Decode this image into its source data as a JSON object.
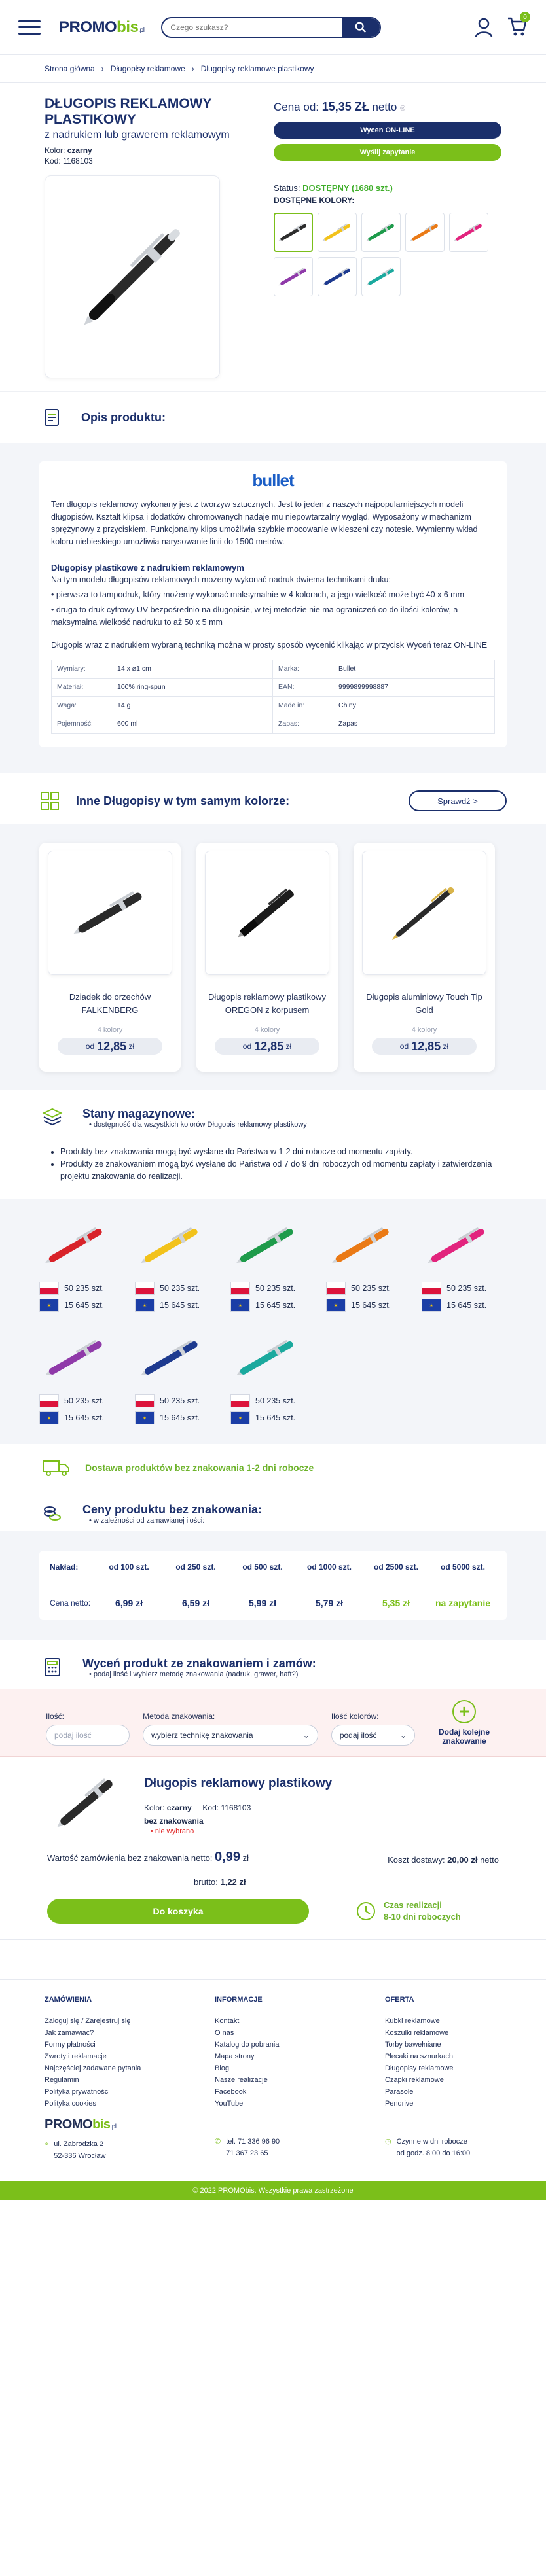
{
  "header": {
    "logo_main": "PROMO",
    "logo_accent": "bis",
    "logo_suffix": ".pl",
    "search_placeholder": "Czego szukasz?",
    "cart_count": "0"
  },
  "breadcrumb": [
    "Strona główna",
    "Długopisy reklamowe",
    "Długopisy reklamowe plastikowy"
  ],
  "product": {
    "title": "DŁUGOPIS REKLAMOWY PLASTIKOWY",
    "subtitle": "z nadrukiem lub grawerem reklamowym",
    "color_label": "Kolor:",
    "color_value": "czarny",
    "code_label": "Kod:",
    "code_value": "1168103",
    "price_prefix": "Cena od:",
    "price_value": "15,35 ZŁ",
    "price_suffix": "netto",
    "btn_online": "Wycen ON-LINE",
    "btn_inquiry": "Wyślij zapytanie",
    "status_label": "Status:",
    "status_value": "DOSTĘPNY (1680 szt.)",
    "available_colors": "DOSTĘPNE KOLORY:",
    "swatches": [
      "#2d2d2d",
      "#f2c21b",
      "#1e9b4b",
      "#ea7a16",
      "#e2247e",
      "#8f3aa9",
      "#1d3a8f",
      "#1ba99e"
    ]
  },
  "description": {
    "heading": "Opis produktu:",
    "brand": "bullet",
    "p1": "Ten długopis reklamowy wykonany jest z tworzyw sztucznych. Jest to jeden z naszych najpopularniejszych modeli długopisów. Kształt klipsa i dodatków chromowanych nadaje mu niepowtarzalny wygląd. Wyposażony w mechanizm sprężynowy z przyciskiem. Funkcjonalny klips umożliwia szybkie mocowanie w kieszeni czy notesie. Wymienny wkład koloru niebieskiego umożliwia narysowanie linii do 1500 metrów.",
    "h2": "Długopisy plastikowe z nadrukiem reklamowym",
    "p2": "Na tym modelu długopisów reklamowych możemy wykonać nadruk dwiema technikami druku:",
    "b1": "• pierwsza to tampodruk, który możemy wykonać maksymalnie w 4 kolorach, a jego wielkość może być 40 x 6 mm",
    "b2": "• druga to druk cyfrowy UV bezpośrednio na długopisie, w tej metodzie nie ma ograniczeń co do ilości kolorów, a maksymalna wielkość nadruku to aż 50 x 5 mm",
    "p3": "Długopis wraz z nadrukiem wybraną techniką można w prosty sposób wycenić klikając w przycisk Wyceń teraz ON-LINE",
    "spec": [
      [
        "Wymiary:",
        "14 x ⌀1 cm"
      ],
      [
        "Marka:",
        "Bullet"
      ],
      [
        "Materiał:",
        "100%  ring-spun"
      ],
      [
        "EAN:",
        "9999899998887"
      ],
      [
        "Waga:",
        "14 g"
      ],
      [
        "Made in:",
        "Chiny"
      ],
      [
        "Pojemność:",
        "600 ml"
      ],
      [
        "Zapas:",
        "Zapas"
      ]
    ]
  },
  "similar": {
    "heading": "Inne Długopisy w tym samym kolorze:",
    "check_btn": "Sprawdź >",
    "cards": [
      {
        "name": "Dziadek do orzechów FALKENBERG",
        "colors": "4 kolory",
        "price_prefix": "od",
        "price": "12,85",
        "unit": "zł"
      },
      {
        "name": "Długopis reklamowy plastikowy OREGON z korpusem",
        "colors": "4 kolory",
        "price_prefix": "od",
        "price": "12,85",
        "unit": "zł"
      },
      {
        "name": "Długopis aluminiowy Touch Tip Gold",
        "colors": "4 kolory",
        "price_prefix": "od",
        "price": "12,85",
        "unit": "zł"
      }
    ]
  },
  "stock": {
    "heading": "Stany magazynowe:",
    "note": "dostępność dla wszystkich kolorów Długopis reklamowy plastikowy",
    "li1": "Produkty bez znakowania mogą być wysłane do Państwa w 1-2 dni robocze od momentu zapłaty.",
    "li2": "Produkty ze znakowaniem mogą być wysłane do Państwa od 7 do 9 dni roboczych od momentu zapłaty i zatwierdzenia projektu znakowania do realizacji.",
    "items": [
      {
        "color": "#d8232a",
        "pl": "50 235 szt.",
        "eu": "15 645 szt."
      },
      {
        "color": "#f2c21b",
        "pl": "50 235 szt.",
        "eu": "15 645 szt."
      },
      {
        "color": "#1e9b4b",
        "pl": "50 235 szt.",
        "eu": "15 645 szt."
      },
      {
        "color": "#ea7a16",
        "pl": "50 235 szt.",
        "eu": "15 645 szt."
      },
      {
        "color": "#e2247e",
        "pl": "50 235 szt.",
        "eu": "15 645 szt."
      },
      {
        "color": "#8f3aa9",
        "pl": "50 235 szt.",
        "eu": "15 645 szt."
      },
      {
        "color": "#1d3a8f",
        "pl": "50 235 szt.",
        "eu": "15 645 szt."
      },
      {
        "color": "#1ba99e",
        "pl": "50 235 szt.",
        "eu": "15 645 szt."
      }
    ],
    "delivery": "Dostawa produktów bez znakowania 1-2 dni robocze"
  },
  "prices": {
    "heading": "Ceny produktu bez znakowania:",
    "note": "w zależności od zamawianej ilości:",
    "row1_label": "Nakład:",
    "quantities": [
      "od 100 szt.",
      "od 250 szt.",
      "od 500 szt.",
      "od 1000 szt.",
      "od 2500 szt.",
      "od 5000 szt."
    ],
    "row2_label": "Cena netto:",
    "values": [
      "6,99 zł",
      "6,59 zł",
      "5,99 zł",
      "5,79 zł",
      "5,35 zł",
      "na zapytanie"
    ]
  },
  "config": {
    "heading": "Wyceń produkt ze znakowaniem i zamów:",
    "note": "podaj ilość i wybierz metodę znakowania (nadruk, grawer, haft?)",
    "qty_label": "Ilość:",
    "qty_placeholder": "podaj ilość",
    "method_label": "Metoda znakowania:",
    "method_value": "wybierz technikę znakowania",
    "colors_label": "Ilość kolorów:",
    "colors_value": "podaj ilość",
    "add_label": "Dodaj kolejne znakowanie"
  },
  "summary": {
    "title": "Długopis reklamowy plastikowy",
    "color_label": "Kolor:",
    "color_value": "czarny",
    "code_label": "Kod:",
    "code_value": "1168103",
    "marking": "bez znakowania",
    "not_chosen": "• nie wybrano",
    "order_label": "Wartość zamówienia bez znakowania netto:",
    "order_value": "0,99",
    "order_unit": "zł",
    "shipping_label": "Koszt dostawy:",
    "shipping_value": "20,00 zł",
    "shipping_suffix": "netto",
    "brutto_label": "brutto:",
    "brutto_value": "1,22 zł",
    "cart_btn": "Do koszyka",
    "time_label": "Czas realizacji",
    "time_value": "8-10 dni roboczych"
  },
  "footer": {
    "col1_title": "ZAMÓWIENIA",
    "col1": [
      "Zaloguj się / Zarejestruj się",
      "Jak zamawiać?",
      "Formy płatności",
      "Zwroty i reklamacje",
      "Najczęściej zadawane pytania",
      "Regulamin",
      "Polityka prywatności",
      "Polityka cookies"
    ],
    "col2_title": "INFORMACJE",
    "col2": [
      "Kontakt",
      "O nas",
      "Katalog do pobrania",
      "Mapa strony",
      "Blog",
      "Nasze realizacje",
      "Facebook",
      "YouTube"
    ],
    "col3_title": "OFERTA",
    "col3": [
      "Kubki reklamowe",
      "Koszulki reklamowe",
      "Torby bawełniane",
      "Plecaki na sznurkach",
      "Długopisy reklamowe",
      "Czapki reklamowe",
      "Parasole",
      "Pendrive"
    ],
    "address1": "ul. Zabrodzka 2",
    "address2": "52-336 Wrocław",
    "phone1": "tel. 71 336 96 90",
    "phone2": "71 367 23 65",
    "hours1": "Czynne w dni robocze",
    "hours2": "od godz. 8:00 do 16:00",
    "copyright": "© 2022 PROMObis. Wszystkie prawa zastrzeżone"
  }
}
